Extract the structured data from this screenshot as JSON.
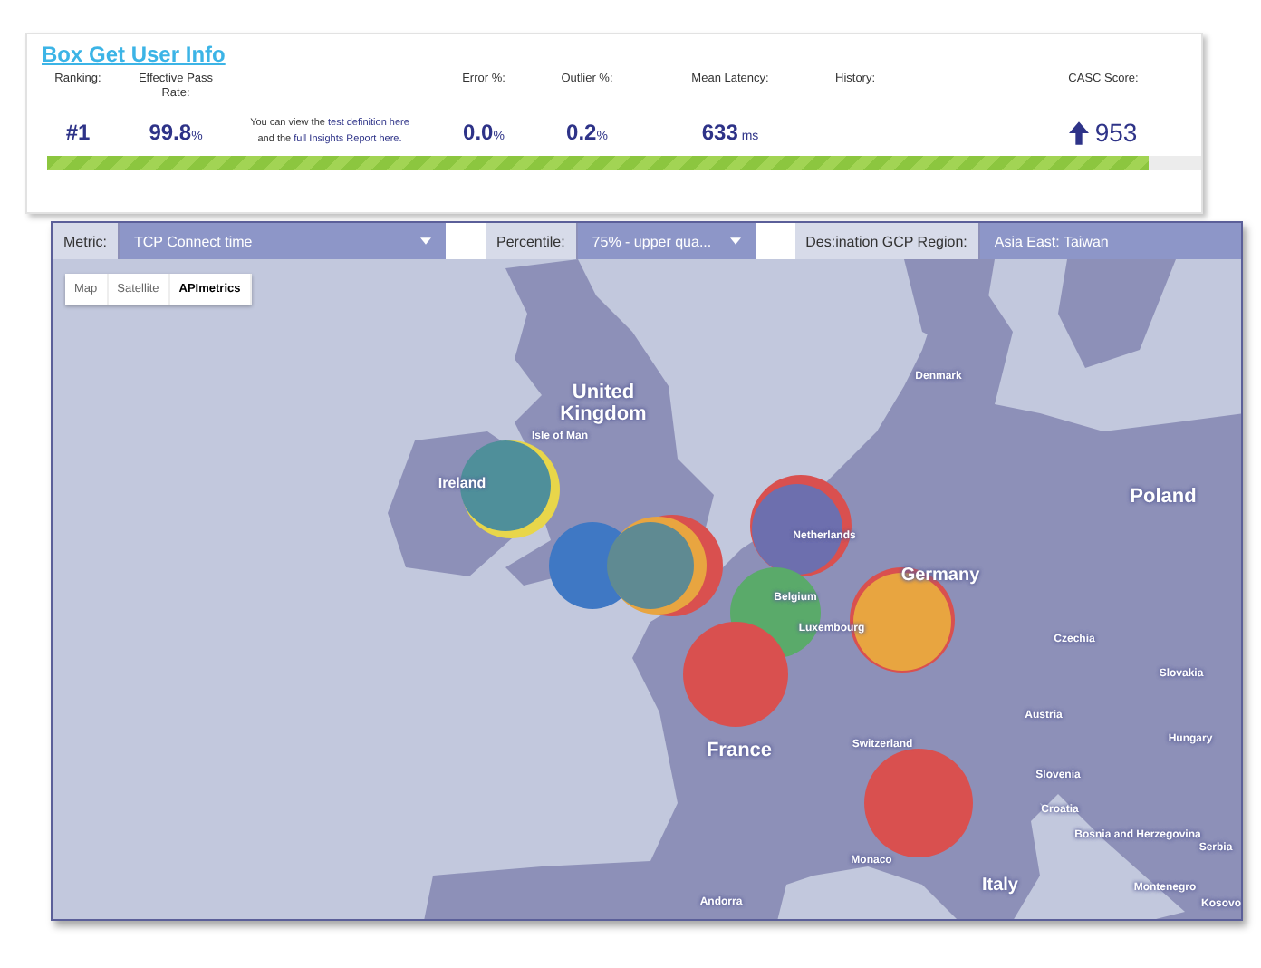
{
  "test_card": {
    "title": "Box Get User Info",
    "stats": [
      {
        "kind": "value",
        "label": "Ranking:",
        "value": "#1"
      },
      {
        "kind": "value",
        "label": "Effective Pass Rate:",
        "value": "99.8",
        "unit": "%"
      },
      {
        "kind": "note",
        "lines": [
          {
            "text": "You can view the ",
            "link": "test definition here"
          },
          {
            "text": "and the ",
            "link": "full Insights Report here."
          }
        ]
      },
      {
        "kind": "value",
        "label": "Error %:",
        "value": "0.0",
        "unit": "%"
      },
      {
        "kind": "value",
        "label": "Outlier %:",
        "value": "0.2",
        "unit": "%"
      },
      {
        "kind": "value",
        "label": "Mean Latency:",
        "value": "633",
        "unit": "ms"
      },
      {
        "kind": "history",
        "label": "History:"
      },
      {
        "kind": "score",
        "label": "CASC Score:",
        "value": "953"
      }
    ],
    "pass_bar": {
      "level": 0.955
    }
  },
  "map_panel": {
    "filters": [
      {
        "label": "Metric:",
        "value": "TCP Connect time",
        "caret": true
      },
      {
        "label": "Percentile:",
        "value": "75% - upper qua...",
        "caret": true
      },
      {
        "label": "Des:ination GCP Region:",
        "value": "Asia East: Taiwan",
        "caret": false
      }
    ],
    "map_types": [
      {
        "label": "Map",
        "selected": false
      },
      {
        "label": "Satellite",
        "selected": false
      },
      {
        "label": "APImetrics",
        "selected": true
      }
    ],
    "places": [
      "United Kingdom",
      "Isle of Man",
      "Ireland",
      "Denmark",
      "Poland",
      "Netherlands",
      "Belgium",
      "Luxembourg",
      "Germany",
      "Czechia",
      "Slovakia",
      "Austria",
      "Hungary",
      "Switzerland",
      "Slovenia",
      "Croatia",
      "Bosnia and Herzegovina",
      "Serbia",
      "Montenegro",
      "Kosovo",
      "France",
      "Italy",
      "Monaco",
      "Andorra"
    ],
    "markers": [
      {
        "color": "#e8d64a"
      },
      {
        "color": "#4f8f9a"
      },
      {
        "color": "#3f78c4"
      },
      {
        "color": "#d9504f"
      },
      {
        "color": "#e8a540"
      },
      {
        "color": "#5f8a92"
      },
      {
        "color": "#d9504f"
      },
      {
        "color": "#6d6fae"
      },
      {
        "color": "#5aaa6a"
      },
      {
        "color": "#d9504f"
      },
      {
        "color": "#d9504f"
      },
      {
        "color": "#e8a540"
      },
      {
        "color": "#d9504f"
      }
    ]
  }
}
